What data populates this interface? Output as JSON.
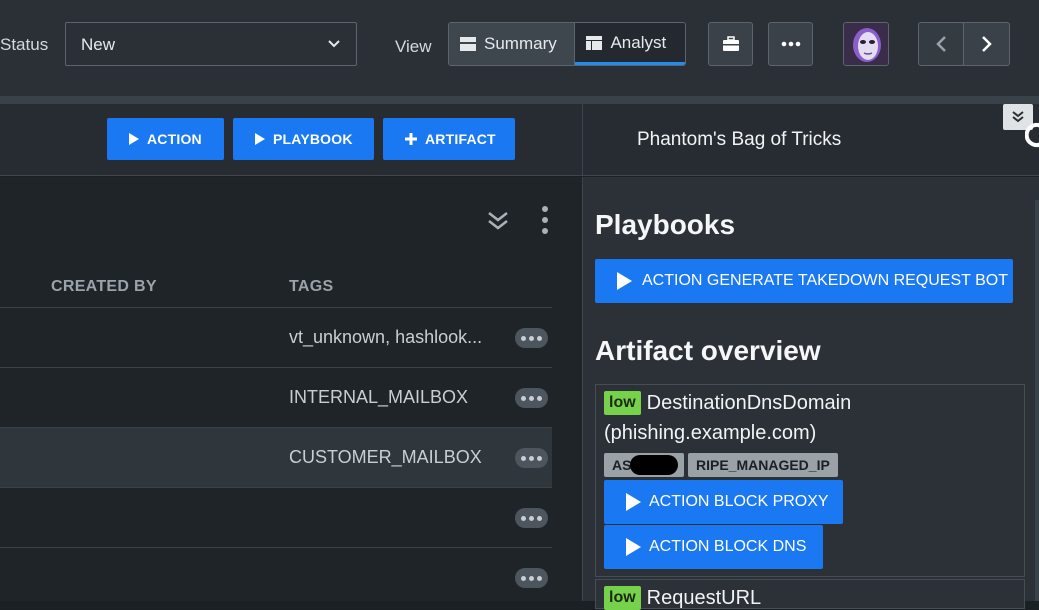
{
  "header": {
    "status_label": "Status",
    "status_value": "New",
    "view_label": "View",
    "view_summary": "Summary",
    "view_analyst": "Analyst"
  },
  "action_bar": {
    "action": "ACTION",
    "playbook": "PLAYBOOK",
    "artifact": "ARTIFACT"
  },
  "side_panel": {
    "title": "Phantom's Bag of Tricks",
    "playbooks_heading": "Playbooks",
    "playbook_button": "ACTION GENERATE TAKEDOWN REQUEST BOT",
    "artifact_heading": "Artifact overview",
    "artifacts": [
      {
        "severity": "low",
        "name": "DestinationDnsDomain",
        "value": "(phishing.example.com)",
        "tags": [
          "AS",
          "RIPE_MANAGED_IP"
        ],
        "actions": [
          "ACTION BLOCK PROXY",
          "ACTION BLOCK DNS"
        ]
      },
      {
        "severity": "low",
        "name": "RequestURL"
      }
    ]
  },
  "table": {
    "columns": [
      "CREATED BY",
      "TAGS"
    ],
    "rows": [
      {
        "tags": "vt_unknown, hashlook..."
      },
      {
        "tags": "INTERNAL_MAILBOX"
      },
      {
        "tags": "CUSTOMER_MAILBOX"
      },
      {
        "tags": ""
      },
      {
        "tags": ""
      }
    ]
  },
  "colors": {
    "accent": "#1a78f2",
    "low_badge": "#76d14b",
    "background": "#1b2024"
  }
}
